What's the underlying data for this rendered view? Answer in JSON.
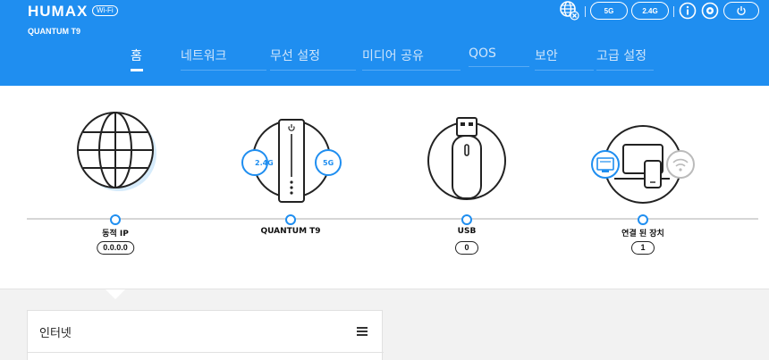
{
  "brand": {
    "name": "HUMAX",
    "badge": "Wi-Fi",
    "model": "QUANTUM T9"
  },
  "top_icons": {
    "globe": "globe-error-icon",
    "band_5g": "5G",
    "band_24g": "2.4G",
    "info": "info-icon",
    "settings": "settings-icon",
    "power": "power-icon"
  },
  "nav": {
    "items": [
      {
        "label": "홈",
        "active": true
      },
      {
        "label": "네트워크",
        "active": false
      },
      {
        "label": "무선 설정",
        "active": false
      },
      {
        "label": "미디어 공유",
        "active": false
      },
      {
        "label": "QOS",
        "active": false
      },
      {
        "label": "보안",
        "active": false
      },
      {
        "label": "고급 설정",
        "active": false
      }
    ]
  },
  "topology": {
    "internet": {
      "label": "동적 IP",
      "value": "0.0.0.0"
    },
    "router": {
      "label": "QUANTUM T9",
      "band_a": "2.4G",
      "band_b": "5G"
    },
    "usb": {
      "label": "USB",
      "value": "0"
    },
    "devices": {
      "label": "연결 된 장치",
      "value": "1"
    }
  },
  "panel": {
    "title": "인터넷"
  },
  "colors": {
    "accent": "#1f8ef0",
    "background": "#f2f2f2"
  }
}
